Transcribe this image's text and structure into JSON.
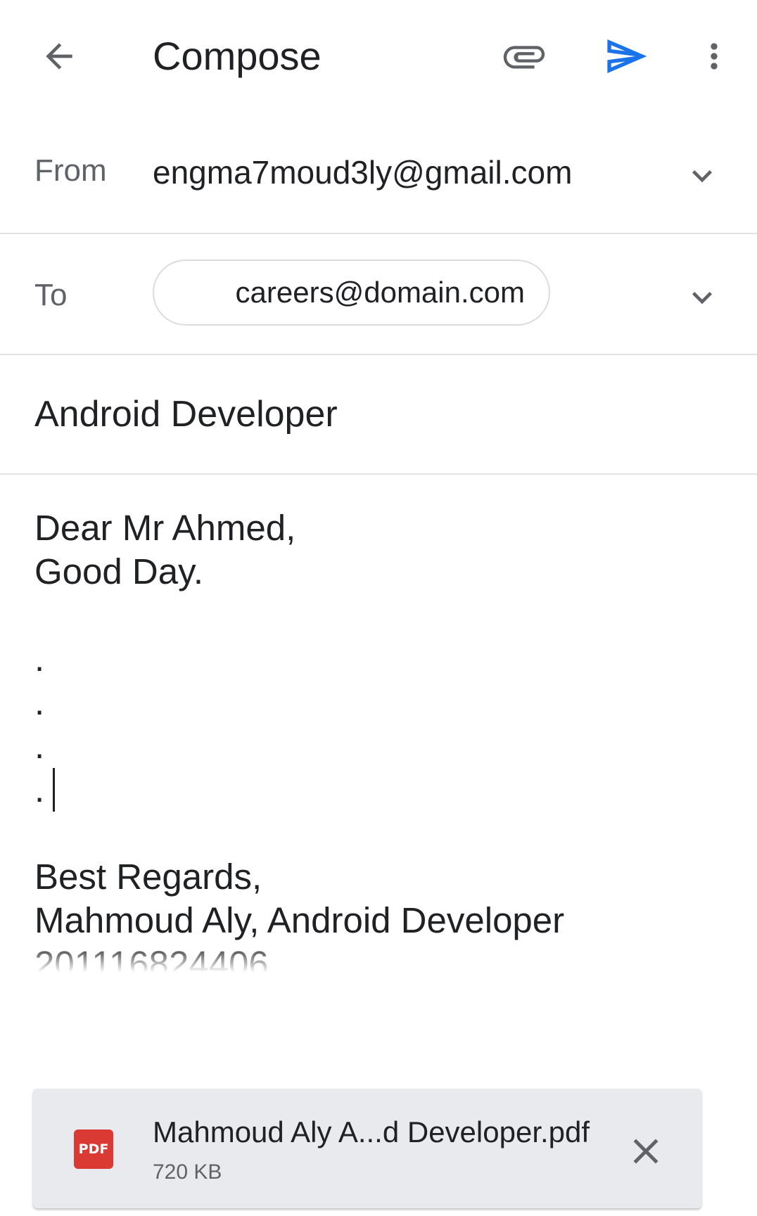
{
  "appbar": {
    "title": "Compose",
    "back_icon": "arrow-left-icon",
    "attach_icon": "paperclip-icon",
    "send_icon": "send-icon",
    "more_icon": "more-vert-icon",
    "send_color": "#1a73e8"
  },
  "from": {
    "label": "From",
    "value": "engma7moud3ly@gmail.com"
  },
  "to": {
    "label": "To",
    "recipient": "careers@domain.com"
  },
  "subject": {
    "value": "Android Developer"
  },
  "body": {
    "lines": [
      "Dear Mr Ahmed,",
      "Good Day.",
      "",
      ".",
      ".",
      ".",
      ".",
      "",
      "Best Regards,",
      "Mahmoud Aly, Android Developer",
      "201116824406"
    ]
  },
  "attachment": {
    "type_badge": "PDF",
    "name": "Mahmoud Aly A...d Developer.pdf",
    "size": "720 KB",
    "badge_color": "#db3a34"
  }
}
